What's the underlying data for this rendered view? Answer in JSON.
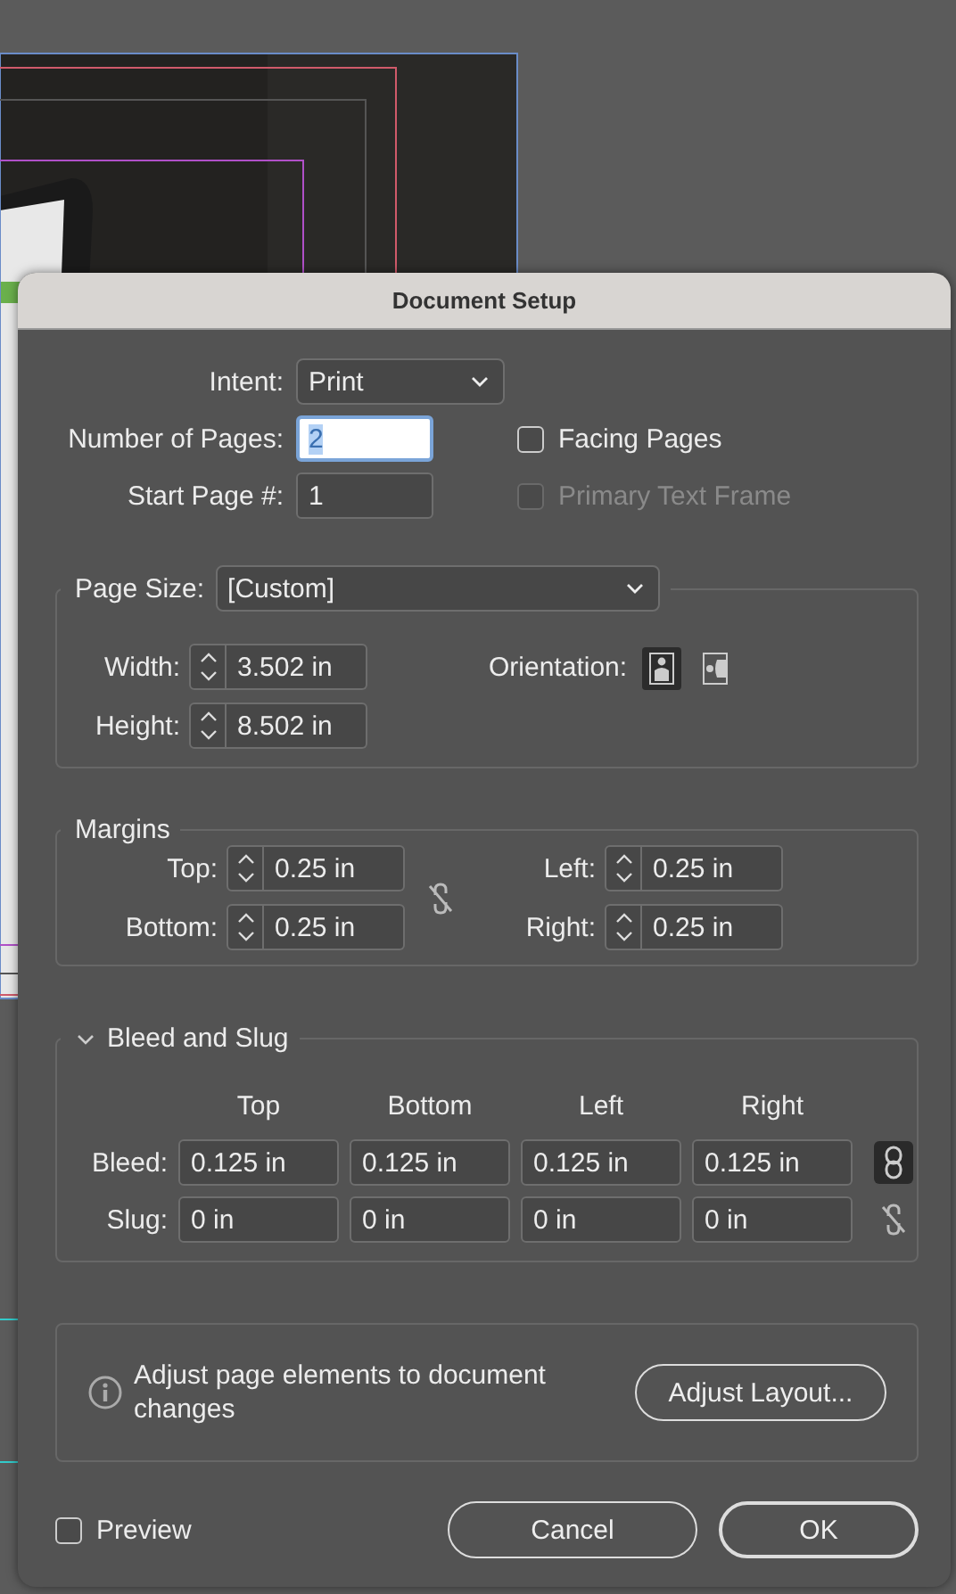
{
  "dialog": {
    "title": "Document Setup"
  },
  "intent": {
    "label": "Intent:",
    "value": "Print"
  },
  "number_of_pages": {
    "label": "Number of Pages:",
    "value": "2",
    "focused": true
  },
  "start_page": {
    "label": "Start Page #:",
    "value": "1"
  },
  "checkboxes": [
    {
      "label": "Facing Pages",
      "checked": false,
      "disabled": false
    },
    {
      "label": "Primary Text Frame",
      "checked": false,
      "disabled": true
    }
  ],
  "page_size": {
    "label": "Page Size:",
    "value": "[Custom]",
    "fields": [
      {
        "label": "Width:",
        "value": "3.502 in"
      },
      {
        "label": "Height:",
        "value": "8.502 in"
      }
    ],
    "orientation": {
      "label": "Orientation:",
      "options": [
        {
          "kind": "portrait",
          "selected": true
        },
        {
          "kind": "landscape",
          "selected": false
        }
      ]
    }
  },
  "margins": {
    "title": "Margins",
    "linked": false,
    "fields": [
      {
        "label": "Top:",
        "value": "0.25 in"
      },
      {
        "label": "Left:",
        "value": "0.25 in"
      },
      {
        "label": "Bottom:",
        "value": "0.25 in"
      },
      {
        "label": "Right:",
        "value": "0.25 in"
      }
    ]
  },
  "bleed_and_slug": {
    "title": "Bleed and Slug",
    "expanded": true,
    "columns": [
      "Top",
      "Bottom",
      "Left",
      "Right"
    ],
    "rows": [
      {
        "label": "Bleed:",
        "values": [
          "0.125 in",
          "0.125 in",
          "0.125 in",
          "0.125 in"
        ],
        "linked": true
      },
      {
        "label": "Slug:",
        "values": [
          "0 in",
          "0 in",
          "0 in",
          "0 in"
        ],
        "linked": false
      }
    ]
  },
  "info": {
    "text": "Adjust page elements to document changes",
    "button": "Adjust Layout..."
  },
  "preview": {
    "label": "Preview",
    "checked": false
  },
  "buttons": [
    {
      "label": "Cancel",
      "kind": "cancel"
    },
    {
      "label": "OK",
      "kind": "default"
    }
  ]
}
